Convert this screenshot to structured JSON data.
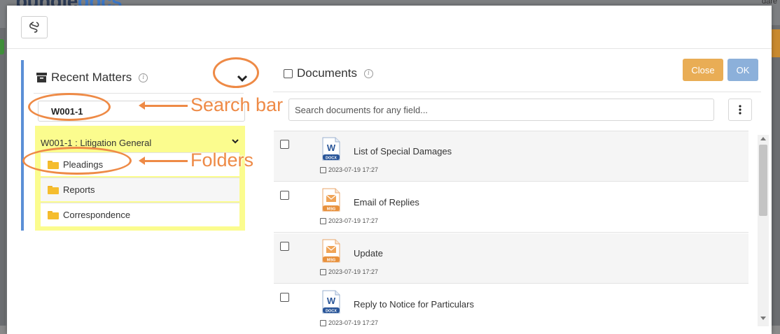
{
  "background": {
    "brand_part1": "bundle",
    "brand_part2": "docs",
    "right_text": "dare"
  },
  "left_panel": {
    "title": "Recent Matters",
    "matter_search_value": "W001-1",
    "matter": {
      "label": "W001-1 : Litigation General",
      "folders": [
        "Pleadings",
        "Reports",
        "Correspondence"
      ]
    }
  },
  "right_panel": {
    "title": "Documents",
    "close_label": "Close",
    "ok_label": "OK",
    "search_placeholder": "Search documents for any field...",
    "documents": [
      {
        "name": "List of Special Damages",
        "type": "DOCX",
        "date": "2023-07-19 17:27"
      },
      {
        "name": "Email of Replies",
        "type": "MSG",
        "date": "2023-07-19 17:27"
      },
      {
        "name": "Update",
        "type": "MSG",
        "date": "2023-07-19 17:27"
      },
      {
        "name": "Reply to Notice for Particulars",
        "type": "DOCX",
        "date": "2023-07-19 17:27"
      }
    ]
  },
  "annotations": {
    "search_bar_label": "Search bar",
    "folders_label": "Folders",
    "color": "#ee8a46"
  },
  "colors": {
    "accent_blue": "#5b8fd6",
    "close_button": "#e9ad55",
    "ok_button": "#8cb0da",
    "highlight": "#fbfc8e"
  }
}
